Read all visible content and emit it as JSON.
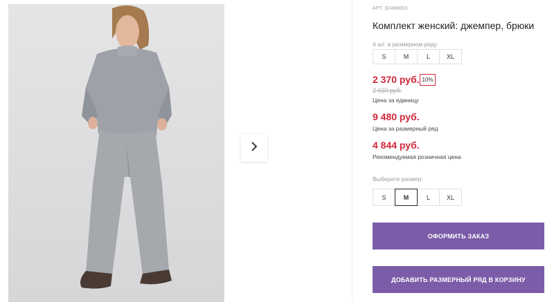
{
  "product": {
    "article": "АРТ. 32466003",
    "title": "Комплект женский: джемпер, брюки"
  },
  "size_row": {
    "label": "4 шт. в размерном ряду",
    "sizes": [
      "S",
      "M",
      "L",
      "XL"
    ]
  },
  "prices": {
    "unit_price": "2 370 руб.",
    "discount_badge": "10%",
    "old_price": "2 630 руб.",
    "unit_label": "Цена за единицу",
    "row_price": "9 480 руб.",
    "row_label": "Цена за размерный ряд",
    "retail_price": "4 844 руб.",
    "retail_label": "Рекомендуемая розничная цена"
  },
  "size_picker": {
    "label": "Выберите размер:",
    "sizes": [
      "S",
      "M",
      "L",
      "XL"
    ],
    "selected": "M"
  },
  "buttons": {
    "order": "ОФОРМИТЬ ЗАКАЗ",
    "add_row": "ДОБАВИТЬ РАЗМЕРНЫЙ РЯД В КОРЗИНУ"
  },
  "icons": {
    "next": "chevron-right-icon"
  },
  "colors": {
    "accent": "#7b5ca8",
    "price": "#d0263a"
  }
}
